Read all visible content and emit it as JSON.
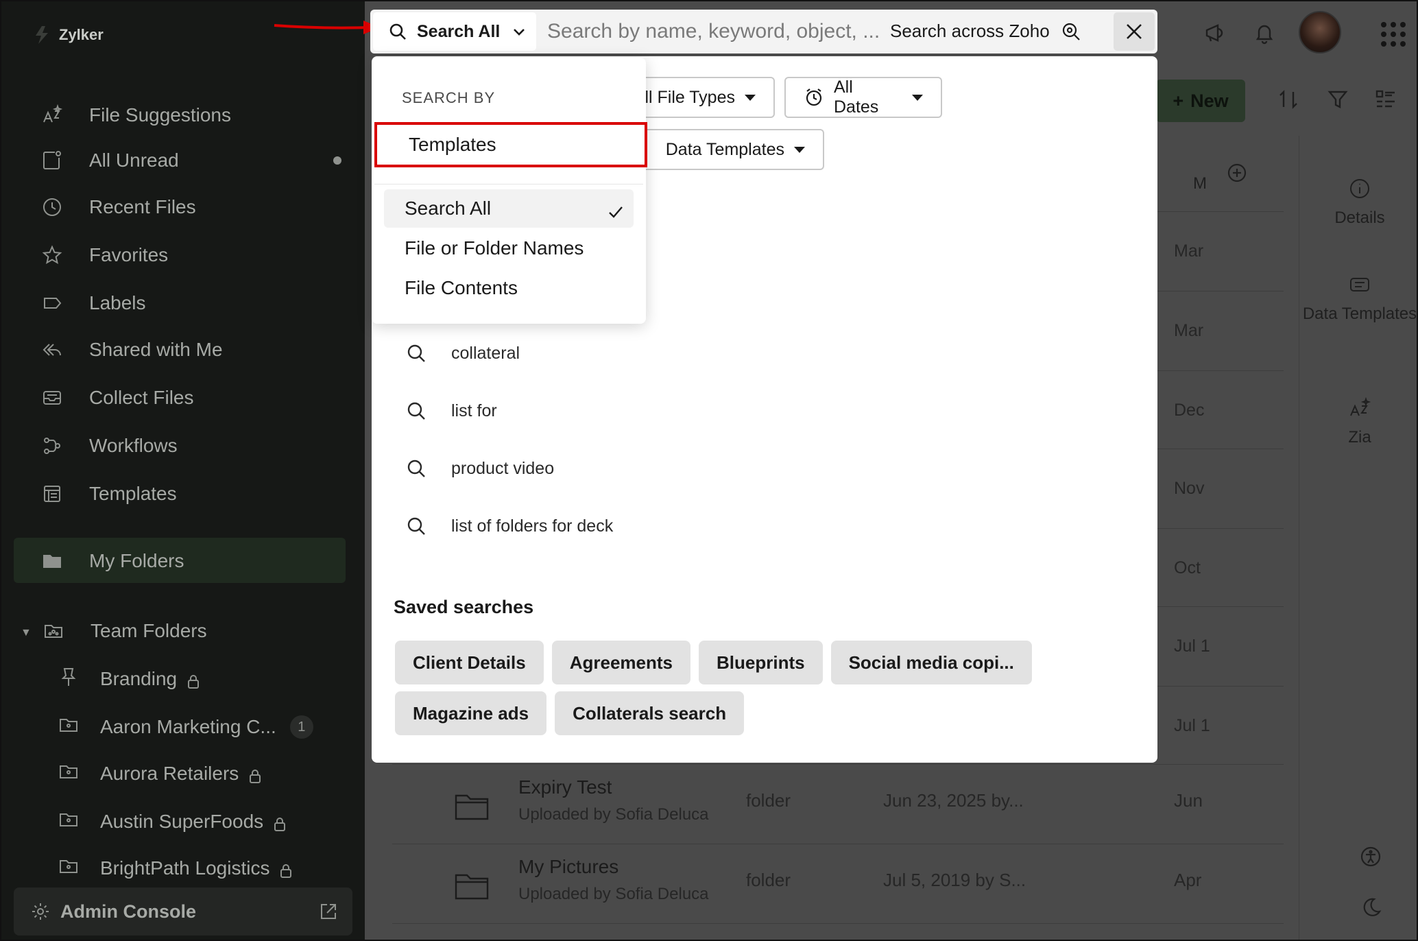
{
  "brand": {
    "name": "Zylker"
  },
  "sidebar": {
    "items": [
      {
        "label": "File Suggestions",
        "icon": "sparkle-icon"
      },
      {
        "label": "All Unread",
        "icon": "unread-icon"
      },
      {
        "label": "Recent Files",
        "icon": "clock-icon"
      },
      {
        "label": "Favorites",
        "icon": "star-icon"
      },
      {
        "label": "Labels",
        "icon": "label-icon"
      },
      {
        "label": "Shared with Me",
        "icon": "share-icon"
      },
      {
        "label": "Collect Files",
        "icon": "inbox-icon"
      },
      {
        "label": "Workflows",
        "icon": "workflow-icon"
      },
      {
        "label": "Templates",
        "icon": "templates-icon"
      }
    ],
    "my_folders": "My Folders",
    "team_folders": "Team Folders",
    "team_items": [
      {
        "label": "Branding",
        "locked": true,
        "icon": "pin-icon"
      },
      {
        "label": "Aaron Marketing C...",
        "badge": "1",
        "icon": "team-folder-icon"
      },
      {
        "label": "Aurora Retailers",
        "locked": true,
        "icon": "team-folder-icon"
      },
      {
        "label": "Austin SuperFoods",
        "locked": true,
        "icon": "team-folder-icon"
      },
      {
        "label": "BrightPath Logistics",
        "locked": true,
        "icon": "team-folder-icon"
      }
    ],
    "admin_console": "Admin Console"
  },
  "search": {
    "scope_label": "Search All",
    "placeholder": "Search by name, keyword, object, ...",
    "across_label": "Search across Zoho"
  },
  "filters": {
    "file_types": "All File Types",
    "dates": "All Dates",
    "templates": "Data Templates"
  },
  "dropdown": {
    "heading": "SEARCH BY",
    "highlighted": "Templates",
    "options": [
      {
        "label": "Search All",
        "selected": true
      },
      {
        "label": "File or Folder Names",
        "selected": false
      },
      {
        "label": "File Contents",
        "selected": false
      }
    ]
  },
  "recent_searches": [
    "collateral",
    "list for",
    "product video",
    "list of folders for deck"
  ],
  "saved_searches": {
    "title": "Saved searches",
    "chips": [
      "Client Details",
      "Agreements",
      "Blueprints",
      "Social media copi...",
      "Magazine ads",
      "Collaterals search"
    ]
  },
  "toolbar": {
    "new_label": "New"
  },
  "right_panel": {
    "details": "Details",
    "data_templates": "Data Templates",
    "zia": "Zia"
  },
  "table": {
    "col_modified": "M",
    "background_dates": [
      "Mar",
      "Mar",
      "Dec",
      "Nov",
      "Oct",
      "Jul 1",
      "Jul 1"
    ],
    "rows": [
      {
        "name": "Expiry Test",
        "sub": "Uploaded by Sofia Deluca",
        "type": "folder",
        "created": "Jun 23, 2025 by...",
        "modified": "Jun"
      },
      {
        "name": "My Pictures",
        "sub": "Uploaded by Sofia Deluca",
        "type": "folder",
        "created": "Jul 5, 2019 by S...",
        "modified": "Apr"
      }
    ]
  },
  "colors": {
    "highlight": "#d90000",
    "sidebar_bg": "#161816",
    "overlay_bg": "#4a4a4a"
  }
}
